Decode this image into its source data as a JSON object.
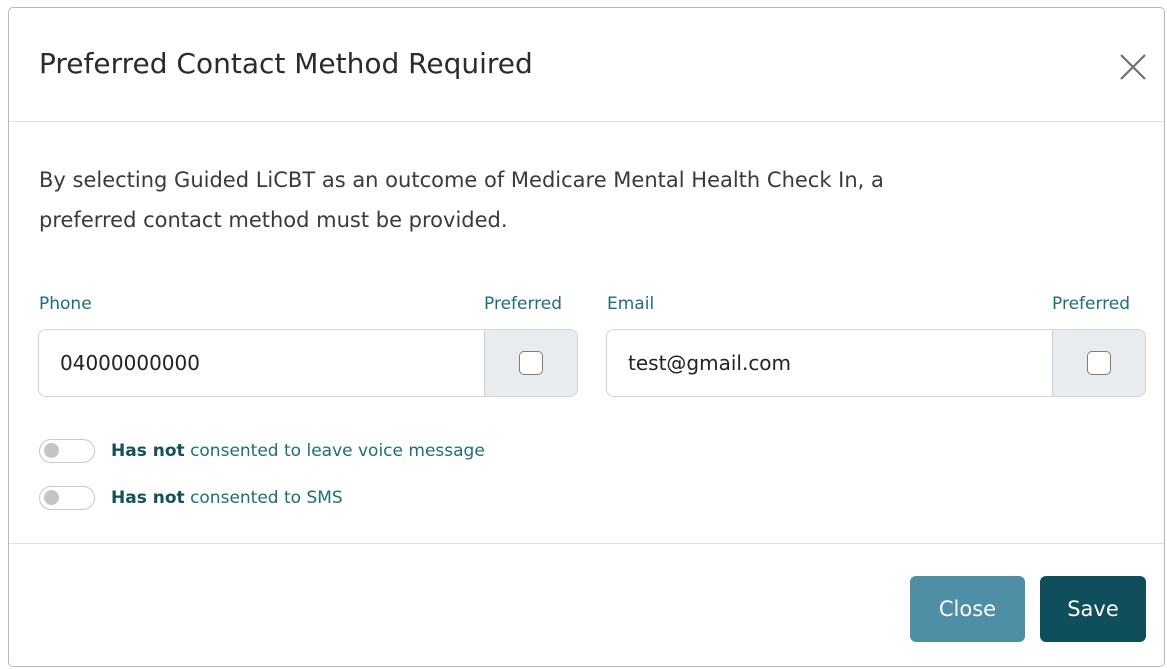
{
  "modal": {
    "title": "Preferred Contact Method Required",
    "intro_line1": "By selecting Guided LiCBT as an outcome of Medicare Mental Health Check In, a",
    "intro_line2": "preferred contact method must be provided."
  },
  "phone": {
    "label": "Phone",
    "preferred_label": "Preferred",
    "value": "04000000000"
  },
  "email": {
    "label": "Email",
    "preferred_label": "Preferred",
    "value": "test@gmail.com"
  },
  "consents": [
    {
      "emphasis": "Has not",
      "text": "consented to leave voice message"
    },
    {
      "emphasis": "Has not",
      "text": "consented to SMS"
    }
  ],
  "footer": {
    "close_label": "Close",
    "save_label": "Save"
  },
  "colors": {
    "label_teal": "#1f6e73",
    "close_button": "#4f8fa6",
    "save_button": "#0f4f5b"
  },
  "icons": {
    "close": "close-icon"
  }
}
